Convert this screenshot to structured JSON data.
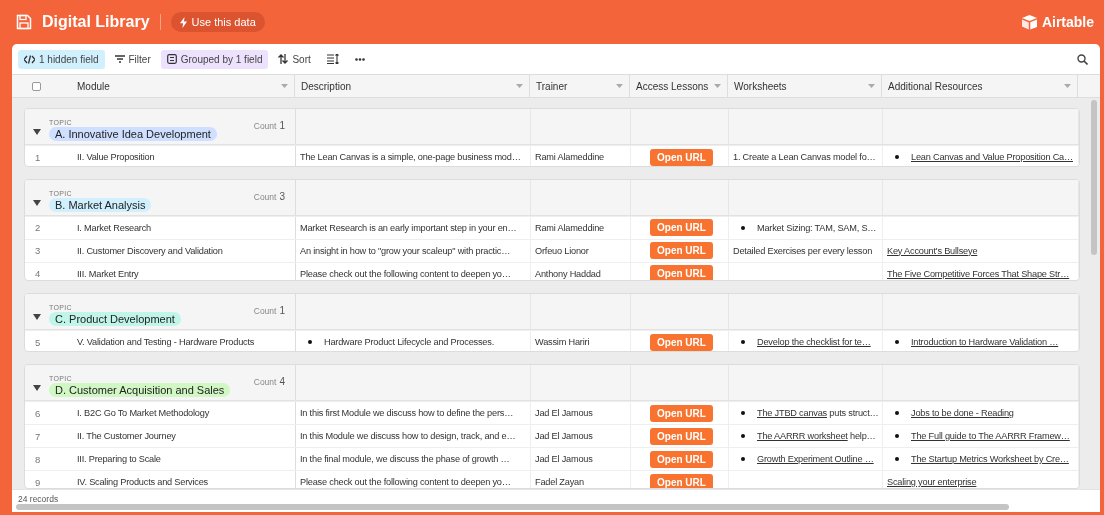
{
  "header": {
    "title": "Digital Library",
    "action": "Use this data",
    "brand": "Airtable"
  },
  "toolbar": [
    {
      "kind": "hidden",
      "label": "1 hidden field"
    },
    {
      "kind": "filter",
      "label": "Filter"
    },
    {
      "kind": "group",
      "label": "Grouped by 1 field"
    },
    {
      "kind": "sort",
      "label": "Sort"
    },
    {
      "kind": "rowheight"
    },
    {
      "kind": "more"
    }
  ],
  "table": {
    "select_all": {
      "checked": false
    },
    "columns": [
      "Module",
      "Description",
      "Trainer",
      "Access Lessons",
      "Worksheets",
      "Additional Resources"
    ],
    "groups": [
      {
        "field": "TOPIC",
        "topic": "A. Innovative Idea Development",
        "color": "#cfdfff",
        "count_label": "Count",
        "count": "1",
        "rows": [
          {
            "n": "1",
            "module": "II. Value Proposition",
            "description": {
              "kind": "text",
              "text": "The Lean Canvas is a simple, one-page business mod…"
            },
            "trainer": "Rami Alameddine",
            "access": "Open URL",
            "worksheets": {
              "kind": "text",
              "text": "1. Create a Lean Canvas model fo…"
            },
            "resources": {
              "kind": "bullet_link",
              "link": "Lean Canvas and Value Proposition Ca…"
            }
          }
        ]
      },
      {
        "field": "TOPIC",
        "topic": "B. Market Analysis",
        "color": "#d0f0fd",
        "count_label": "Count",
        "count": "3",
        "rows": [
          {
            "n": "2",
            "module": "I. Market Research",
            "description": {
              "kind": "text",
              "text": "Market Research is an early important step in your en…"
            },
            "trainer": "Rami Alameddine",
            "access": "Open URL",
            "worksheets": {
              "kind": "bullet",
              "text": "Market Sizing: TAM, SAM, S…"
            },
            "resources": null
          },
          {
            "n": "3",
            "module": "II. Customer Discovery and Validation",
            "description": {
              "kind": "text",
              "text": "An insight in how to \"grow your scaleup\" with practic…"
            },
            "trainer": "Orfeuo Lionor",
            "access": "Open URL",
            "worksheets": {
              "kind": "text",
              "text": "Detailed Exercises per every lesson"
            },
            "resources": {
              "kind": "link",
              "link": "Key Account's Bullseye"
            }
          },
          {
            "n": "4",
            "module": "III. Market Entry",
            "description": {
              "kind": "text",
              "text": "Please check out the following content to deepen yo…"
            },
            "trainer": "Anthony Haddad",
            "access": "Open URL",
            "worksheets": null,
            "resources": {
              "kind": "link",
              "link": "The Five Competitive Forces That Shape Str…"
            }
          }
        ]
      },
      {
        "field": "TOPIC",
        "topic": "C. Product Development",
        "color": "#c2f5e9",
        "count_label": "Count",
        "count": "1",
        "rows": [
          {
            "n": "5",
            "module": "V. Validation and Testing - Hardware Products",
            "description": {
              "kind": "bullet",
              "text": "Hardware Product Lifecycle and Processes."
            },
            "trainer": "Wassim Hariri",
            "access": "Open URL",
            "worksheets": {
              "kind": "bullet_link",
              "link": "Develop the checklist for te…"
            },
            "resources": {
              "kind": "bullet_link",
              "link": "Introduction to Hardware Validation …"
            }
          }
        ]
      },
      {
        "field": "TOPIC",
        "topic": "D. Customer Acquisition and Sales",
        "color": "#d1f7c4",
        "count_label": "Count",
        "count": "4",
        "rows": [
          {
            "n": "6",
            "module": "I. B2C Go To Market Methodology",
            "description": {
              "kind": "text",
              "text": "In this first Module we discuss how to define the pers…"
            },
            "trainer": "Jad El Jamous",
            "access": "Open URL",
            "worksheets": {
              "kind": "bullet_link",
              "link": "The JTBD canvas",
              "rest": " puts struct…"
            },
            "resources": {
              "kind": "bullet_link",
              "link": "Jobs to be done - Reading"
            }
          },
          {
            "n": "7",
            "module": "II. The Customer Journey",
            "description": {
              "kind": "text",
              "text": "In this Module we discuss how to design, track, and e…"
            },
            "trainer": "Jad El Jamous",
            "access": "Open URL",
            "worksheets": {
              "kind": "bullet_link",
              "link": "The AARRR worksheet",
              "rest": " help…"
            },
            "resources": {
              "kind": "bullet_link",
              "link": "The Full guide to The AARRR Framew…"
            }
          },
          {
            "n": "8",
            "module": "III. Preparing to Scale",
            "description": {
              "kind": "text",
              "text": "In the final module, we discuss the phase of growth …"
            },
            "trainer": "Jad El Jamous",
            "access": "Open URL",
            "worksheets": {
              "kind": "bullet_link",
              "link": "Growth Experiment Outline …"
            },
            "resources": {
              "kind": "bullet_link",
              "link": "The Startup Metrics Worksheet by Cre…"
            }
          },
          {
            "n": "9",
            "module": "IV. Scaling Products and Services",
            "description": {
              "kind": "text",
              "text": "Please check out the following content to deepen yo…"
            },
            "trainer": "Fadel Zayan",
            "access": "Open URL",
            "worksheets": null,
            "resources": {
              "kind": "link",
              "link": "Scaling your enterprise"
            }
          }
        ]
      }
    ]
  },
  "status_bar": "24 records"
}
